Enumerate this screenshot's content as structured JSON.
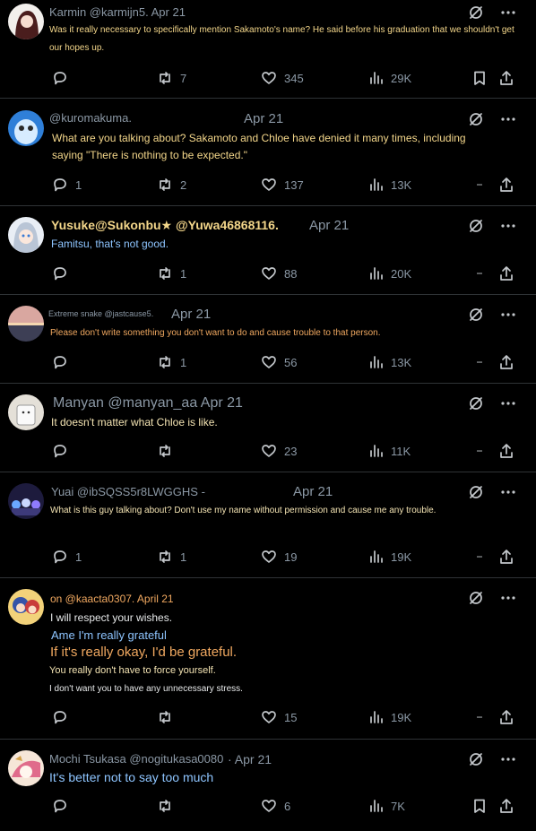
{
  "colors": {
    "background": "#000000",
    "divider": "#2f3336",
    "muted": "#8b98a5",
    "text_white": "#e7e9ea",
    "text_yellow": "#f3d68a",
    "text_blue": "#8ec5ff",
    "text_orange": "#f0a860",
    "text_cream": "#f4e4b3"
  },
  "posts": [
    {
      "header": "Karmin @karmijn5. Apr 21",
      "date": "",
      "lines": [
        "Was it really necessary to specifically mention Sakamoto's name? He said before his graduation that we shouldn't get",
        "our hopes up."
      ],
      "reply_count": "",
      "repost_count": "7",
      "like_count": "345",
      "view_count": "29K"
    },
    {
      "header": "@kuromakuma.",
      "date": "Apr 21",
      "lines": [
        "What are you talking about? Sakamoto and Chloe have denied it many times, including",
        "saying \"There is nothing to be expected.\""
      ],
      "reply_count": "1",
      "repost_count": "2",
      "like_count": "137",
      "view_count": "13K"
    },
    {
      "header": "Yusuke@Sukonbu★ @Yuwa46868116.",
      "date": "Apr 21",
      "lines": [
        "Famitsu, that's not good."
      ],
      "reply_count": "",
      "repost_count": "1",
      "like_count": "88",
      "view_count": "20K"
    },
    {
      "header": "Extreme snake @jastcause5.",
      "date": "Apr 21",
      "lines": [
        "Please don't write something you don't want to do and cause trouble to that person."
      ],
      "reply_count": "",
      "repost_count": "1",
      "like_count": "56",
      "view_count": "13K"
    },
    {
      "header": "Manyan @manyan_aa Apr 21",
      "date": "",
      "lines": [
        "It doesn't matter what Chloe is like."
      ],
      "reply_count": "",
      "repost_count": "",
      "like_count": "23",
      "view_count": "11K"
    },
    {
      "header": "Yuai @ibSQSS5r8LWGGHS -",
      "date": "Apr 21",
      "lines": [
        "What is this guy talking about? Don't use my name without permission and cause me any trouble."
      ],
      "reply_count": "1",
      "repost_count": "1",
      "like_count": "19",
      "view_count": "19K"
    },
    {
      "header": "on @kaacta0307. April 21",
      "date": "",
      "lines": [
        "I will respect your wishes.",
        "Ame I'm really grateful",
        "If it's really okay, I'd be grateful.",
        "You really don't have to force yourself.",
        "I don't want you to have any unnecessary stress."
      ],
      "reply_count": "",
      "repost_count": "",
      "like_count": "15",
      "view_count": "19K"
    },
    {
      "header": "Mochi Tsukasa @nogitukasa0080",
      "date": "· Apr 21",
      "lines": [
        "It's better not to say too much"
      ],
      "reply_count": "",
      "repost_count": "",
      "like_count": "6",
      "view_count": "7K"
    }
  ]
}
